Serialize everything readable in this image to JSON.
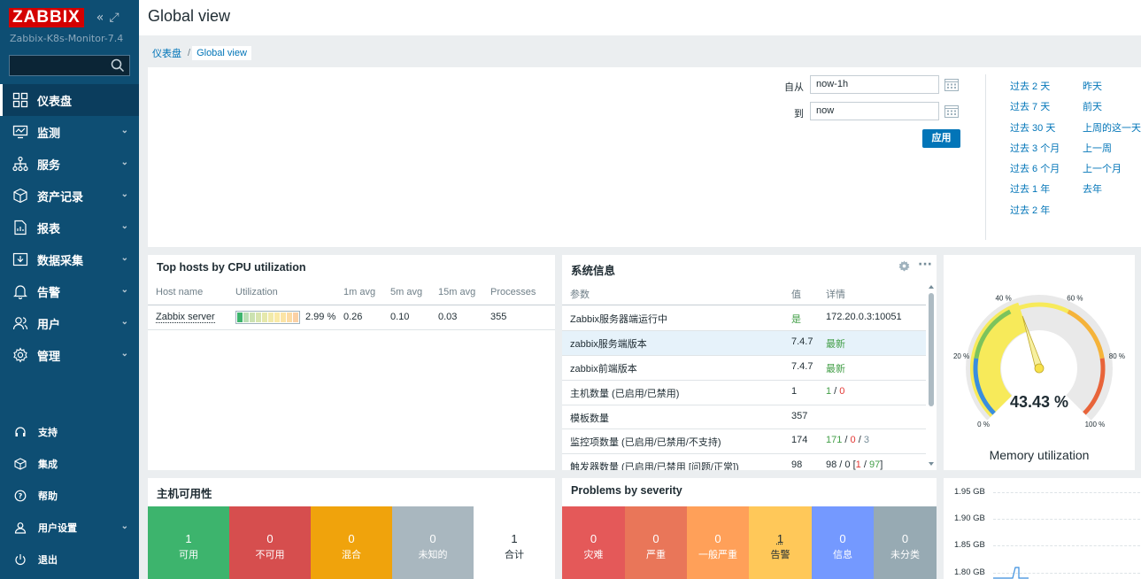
{
  "app": {
    "logo": "ZABBIX",
    "server_name": "Zabbix-K8s-Monitor-7.4"
  },
  "sidebar": {
    "search_placeholder": "",
    "items": [
      {
        "label": "仪表盘",
        "icon": "dashboard-icon",
        "active": true,
        "expandable": false
      },
      {
        "label": "监测",
        "icon": "monitoring-icon",
        "active": false,
        "expandable": true
      },
      {
        "label": "服务",
        "icon": "services-icon",
        "active": false,
        "expandable": true
      },
      {
        "label": "资产记录",
        "icon": "inventory-icon",
        "active": false,
        "expandable": true
      },
      {
        "label": "报表",
        "icon": "reports-icon",
        "active": false,
        "expandable": true
      },
      {
        "label": "数据采集",
        "icon": "data-collection-icon",
        "active": false,
        "expandable": true
      },
      {
        "label": "告警",
        "icon": "alerts-icon",
        "active": false,
        "expandable": true
      },
      {
        "label": "用户",
        "icon": "users-icon",
        "active": false,
        "expandable": true
      },
      {
        "label": "管理",
        "icon": "administration-icon",
        "active": false,
        "expandable": true
      }
    ],
    "bottom_items": [
      {
        "label": "支持",
        "icon": "support-icon"
      },
      {
        "label": "集成",
        "icon": "integrations-icon"
      },
      {
        "label": "帮助",
        "icon": "help-icon"
      },
      {
        "label": "用户设置",
        "icon": "user-settings-icon",
        "expandable": true
      },
      {
        "label": "退出",
        "icon": "sign-out-icon"
      }
    ]
  },
  "header": {
    "title": "Global view"
  },
  "breadcrumb": {
    "root": "仪表盘",
    "separator": "/",
    "current": "Global view"
  },
  "time_filter": {
    "from_label": "自从",
    "from_value": "now-1h",
    "to_label": "到",
    "to_value": "now",
    "apply_label": "应用",
    "quick_col1": [
      "过去 2 天",
      "过去 7 天",
      "过去 30 天",
      "过去 3 个月",
      "过去 6 个月",
      "过去 1 年",
      "过去 2 年"
    ],
    "quick_col2": [
      "昨天",
      "前天",
      "上周的这一天",
      "上一周",
      "上一个月",
      "去年"
    ]
  },
  "top_hosts": {
    "title": "Top hosts by CPU utilization",
    "columns": [
      "Host name",
      "Utilization",
      "1m avg",
      "5m avg",
      "15m avg",
      "Processes"
    ],
    "rows": [
      {
        "host": "Zabbix server",
        "utilization": "2.99 %",
        "utilization_fraction": 0.0299,
        "avg1": "0.26",
        "avg5": "0.10",
        "avg15": "0.03",
        "processes": "355"
      }
    ]
  },
  "system_info": {
    "title": "系统信息",
    "columns": [
      "参数",
      "值",
      "详情"
    ],
    "rows": [
      {
        "param": "Zabbix服务器端运行中",
        "value": "是",
        "value_color": "green",
        "details": "172.20.0.3:10051"
      },
      {
        "param": "zabbix服务端版本",
        "value": "7.4.7",
        "details_latest": "最新",
        "highlight": true
      },
      {
        "param": "zabbix前端版本",
        "value": "7.4.7",
        "details_latest": "最新"
      },
      {
        "param": "主机数量 (已启用/已禁用)",
        "value": "1",
        "d1": "1",
        "d2": "0"
      },
      {
        "param": "模板数量",
        "value": "357"
      },
      {
        "param": "监控项数量 (已启用/已禁用/不支持)",
        "value": "174",
        "d1": "171",
        "d2": "0",
        "d3": "3"
      },
      {
        "param": "触发器数量 (已启用/已禁用 [问题/正常])",
        "value": "98",
        "t1": "98",
        "t2": "0",
        "t3": "1",
        "t4": "97"
      }
    ]
  },
  "memory_gauge": {
    "title": "Memory utilization",
    "value_text": "43.43 %",
    "value": 43.43,
    "min": 0,
    "max": 100,
    "ticks": [
      "0 %",
      "20 %",
      "40 %",
      "60 %",
      "80 %",
      "100 %"
    ]
  },
  "host_availability": {
    "title": "主机可用性",
    "cells": [
      {
        "count": "1",
        "label": "可用",
        "color": "#3db46d"
      },
      {
        "count": "0",
        "label": "不可用",
        "color": "#d64e4e"
      },
      {
        "count": "0",
        "label": "混合",
        "color": "#f0a30c"
      },
      {
        "count": "0",
        "label": "未知的",
        "color": "#a9b7bf"
      },
      {
        "count": "1",
        "label": "合计",
        "color": "#ffffff"
      }
    ]
  },
  "problems_by_severity": {
    "title": "Problems by severity",
    "cells": [
      {
        "count": "0",
        "label": "灾难",
        "color": "#e45959"
      },
      {
        "count": "0",
        "label": "严重",
        "color": "#e97659"
      },
      {
        "count": "0",
        "label": "一般严重",
        "color": "#ffa059"
      },
      {
        "count": "1",
        "label": "告警",
        "color": "#ffc859"
      },
      {
        "count": "0",
        "label": "信息",
        "color": "#7499ff"
      },
      {
        "count": "0",
        "label": "未分类",
        "color": "#97aab3"
      }
    ]
  },
  "mini_graph": {
    "ticks": [
      "1.95 GB",
      "1.90 GB",
      "1.85 GB",
      "1.80 GB"
    ]
  }
}
